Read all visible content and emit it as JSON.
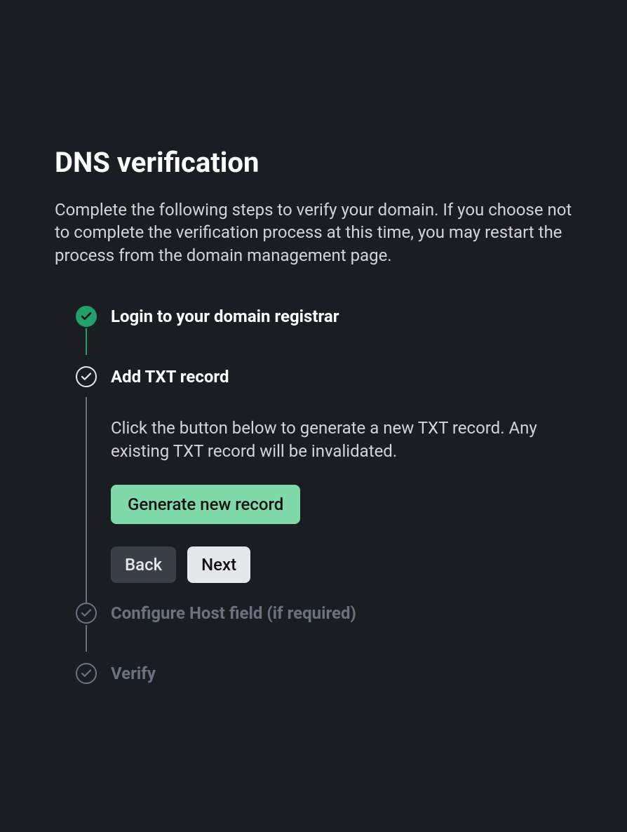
{
  "header": {
    "title": "DNS verification",
    "description": "Complete the following steps to verify your domain. If you choose not to complete the verification process at this time, you may restart the process from the domain management page."
  },
  "steps": [
    {
      "title": "Login to your domain registrar",
      "status": "completed"
    },
    {
      "title": "Add TXT record",
      "status": "current",
      "description": "Click the button below to generate a new TXT record. Any existing TXT record will be invalidated.",
      "primary_button_label": "Generate new record",
      "back_label": "Back",
      "next_label": "Next"
    },
    {
      "title": "Configure Host field (if required)",
      "status": "upcoming"
    },
    {
      "title": "Verify",
      "status": "upcoming"
    }
  ]
}
